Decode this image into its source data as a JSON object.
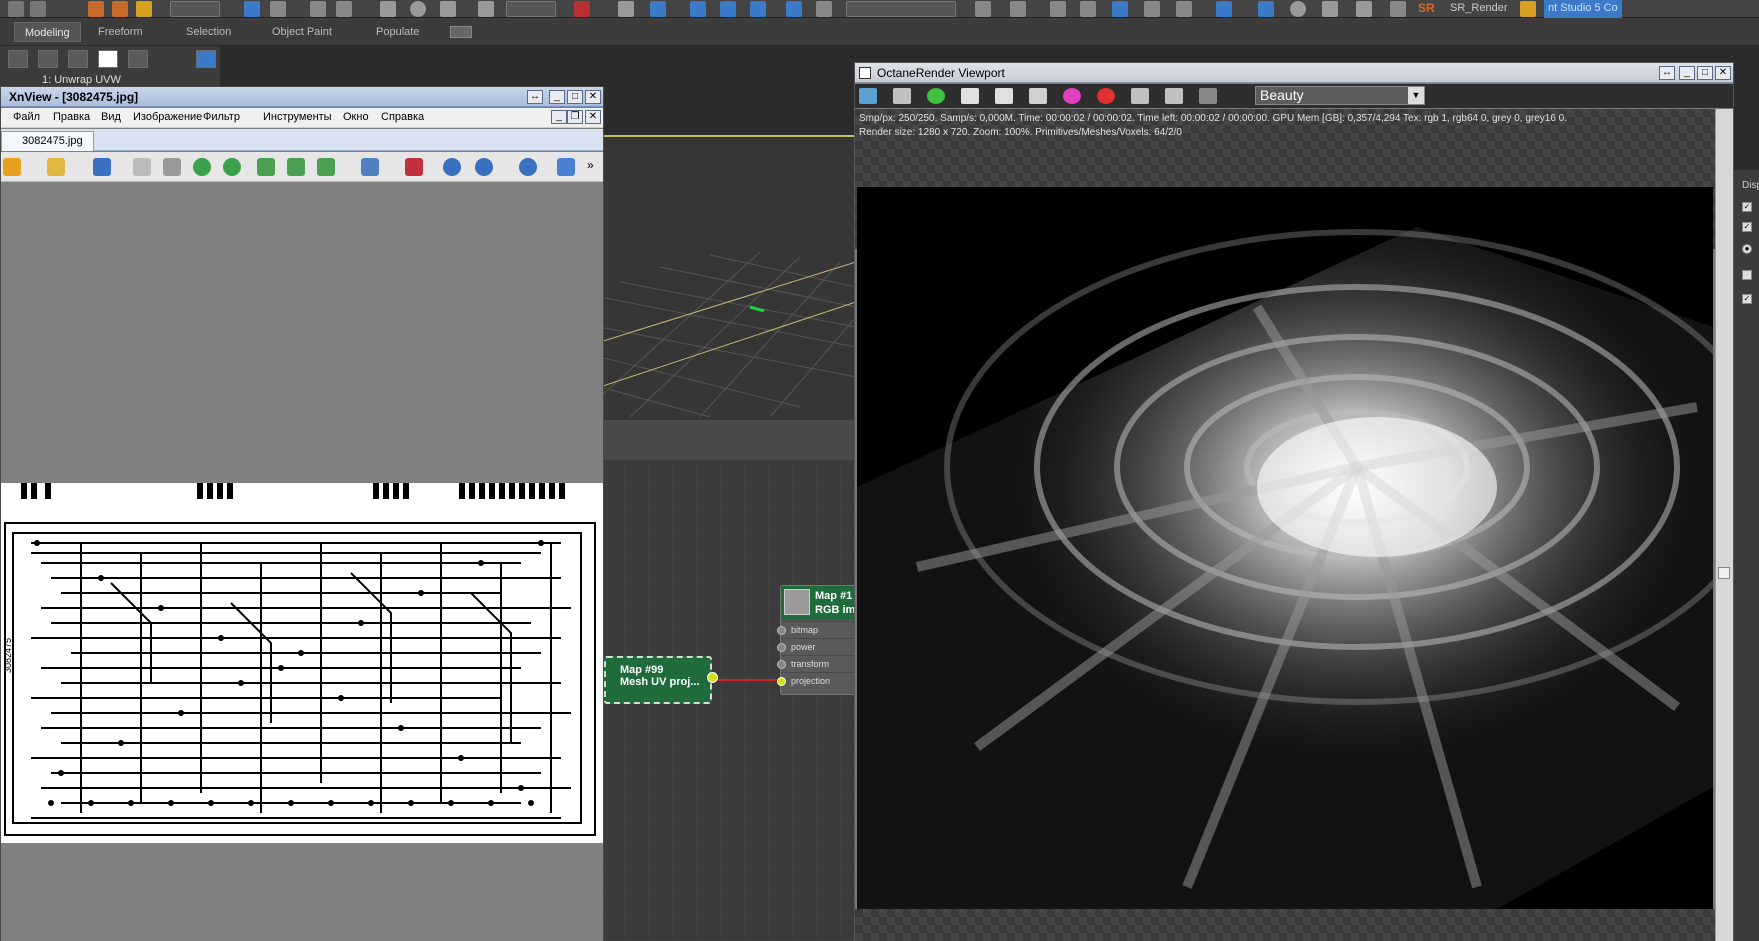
{
  "max_toolbar": {
    "render_label": "SR_Render",
    "studio_label": "nt Studio 5 Co"
  },
  "ribbon": {
    "tabs": [
      "Modeling",
      "Freeform",
      "Selection",
      "Object Paint",
      "Populate"
    ],
    "modifier_label": "1: Unwrap UVW"
  },
  "xnview": {
    "title": "XnView - [3082475.jpg]",
    "menu": [
      "Файл",
      "Правка",
      "Вид",
      "Изображение",
      "Фильтр",
      "Инструменты",
      "Окно",
      "Справка"
    ],
    "tab_label": "3082475.jpg",
    "pcb_side_label": "3082475"
  },
  "slate": {
    "mesh_node": {
      "line1": "Map #99",
      "line2": "Mesh UV proj..."
    },
    "map_node": {
      "line1": "Map #1",
      "line2": "RGB im",
      "ports": [
        "bitmap",
        "power",
        "transform",
        "projection"
      ]
    }
  },
  "octane": {
    "title": "OctaneRender Viewport",
    "pass_select": "Beauty",
    "stats_line1": "Smp/px: 250/250.   Samp/s: 0,000M.   Time: 00:00:02 / 00:00:02.   Time left: 00:00:02 / 00:00:00.   GPU Mem [GB]: 0,357/4,294   Tex: rgb 1, rgb64 0, grey 0, grey16 0.",
    "stats_line2": "Render size: 1280 x 720.   Zoom: 100%.   Primitives/Meshes/Voxels: 64/2/0"
  },
  "colors": {
    "max_bg": "#2b2b2b",
    "node_green": "#1f6b3c",
    "link_red": "#d02020",
    "yellow_port": "#d6e020"
  },
  "cmd_panel": {
    "label": "Disp"
  }
}
